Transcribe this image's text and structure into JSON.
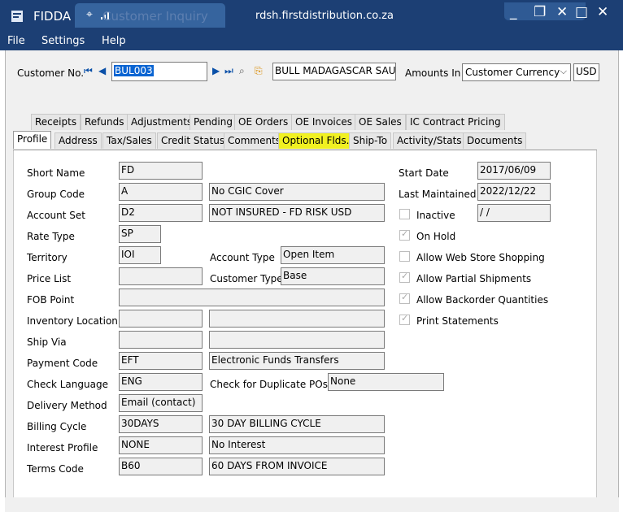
{
  "titlebar": {
    "app_title": "FIDDA",
    "faded_title": "Customer Inquiry",
    "host": "rdsh.firstdistribution.co.za",
    "min_glyph": "_",
    "restore_glyph": "❐",
    "x_glyph": "✕",
    "max_glyph": "□",
    "close_glyph": "✕"
  },
  "menu": {
    "file": "File",
    "settings": "Settings",
    "help": "Help"
  },
  "header": {
    "customer_no_label": "Customer No.",
    "customer_no_value": "BUL003",
    "customer_name": "BULL MADAGASCAR SAU",
    "amounts_in_label": "Amounts In",
    "amounts_in_value": "Customer Currency",
    "currency": "USD",
    "nav": {
      "first": "⏮",
      "prev": "◀",
      "next": "▶",
      "last": "⏭",
      "find": "⌕",
      "new": "⎘"
    }
  },
  "tabs_row1": [
    "Receipts",
    "Refunds",
    "Adjustments",
    "Pending",
    "OE Orders",
    "OE Invoices",
    "OE Sales",
    "IC Contract Pricing"
  ],
  "tabs_row2": [
    "Profile",
    "Address",
    "Tax/Sales",
    "Credit Status",
    "Comments",
    "Optional Flds.",
    "Ship-To",
    "Activity/Stats",
    "Documents"
  ],
  "profile": {
    "short_name": {
      "label": "Short Name",
      "value": "FD"
    },
    "group_code": {
      "label": "Group Code",
      "value": "A",
      "desc": "No CGIC Cover"
    },
    "account_set": {
      "label": "Account Set",
      "value": "D2",
      "desc": "NOT INSURED - FD RISK USD"
    },
    "rate_type": {
      "label": "Rate Type",
      "value": "SP"
    },
    "territory": {
      "label": "Territory",
      "value": "IOI"
    },
    "account_type": {
      "label": "Account Type",
      "value": "Open Item"
    },
    "price_list": {
      "label": "Price List",
      "value": ""
    },
    "customer_type": {
      "label": "Customer Type",
      "value": "Base"
    },
    "fob_point": {
      "label": "FOB Point",
      "value": ""
    },
    "inventory_location": {
      "label": "Inventory Location",
      "value": ""
    },
    "ship_via": {
      "label": "Ship Via",
      "value": ""
    },
    "payment_code": {
      "label": "Payment Code",
      "value": "EFT",
      "desc": "Electronic Funds Transfers"
    },
    "check_language": {
      "label": "Check Language",
      "value": "ENG"
    },
    "check_dup_pos": {
      "label": "Check for Duplicate POs",
      "value": "None"
    },
    "delivery_method": {
      "label": "Delivery Method",
      "value": "Email (contact)"
    },
    "billing_cycle": {
      "label": "Billing Cycle",
      "value": "30DAYS",
      "desc": "30 DAY BILLING CYCLE"
    },
    "interest_profile": {
      "label": "Interest Profile",
      "value": "NONE",
      "desc": "No Interest"
    },
    "terms_code": {
      "label": "Terms Code",
      "value": "B60",
      "desc": "60  DAYS FROM INVOICE"
    },
    "start_date": {
      "label": "Start Date",
      "value": "2017/06/09"
    },
    "last_maintained": {
      "label": "Last Maintained",
      "value": "2022/12/22"
    },
    "inactive": {
      "label": "Inactive",
      "value": " /  /"
    },
    "on_hold": "On Hold",
    "allow_web_store": "Allow Web Store Shopping",
    "allow_partial": "Allow Partial Shipments",
    "allow_backorder": "Allow Backorder Quantities",
    "print_statements": "Print Statements"
  },
  "colors": {
    "titlebar": "#1c3f74",
    "highlight": "#f1f121",
    "selection": "#0a64d2"
  }
}
